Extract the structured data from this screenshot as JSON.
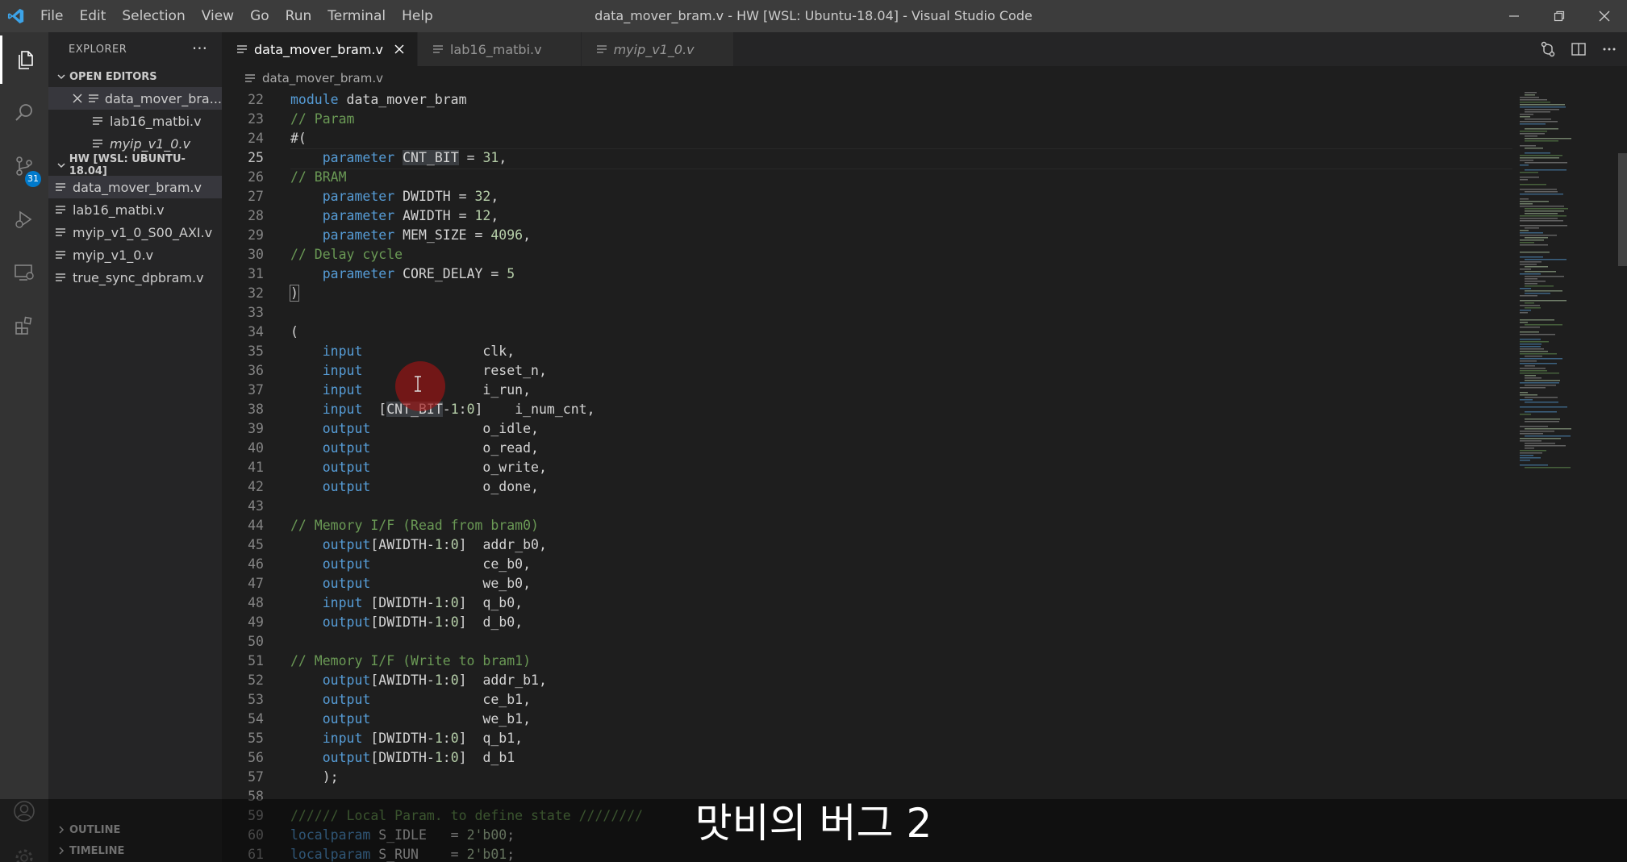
{
  "titlebar": {
    "menu": [
      "File",
      "Edit",
      "Selection",
      "View",
      "Go",
      "Run",
      "Terminal",
      "Help"
    ],
    "title": "data_mover_bram.v - HW [WSL: Ubuntu-18.04] - Visual Studio Code"
  },
  "activity": {
    "scm_badge": "31"
  },
  "sidebar": {
    "header": "EXPLORER",
    "more": "···",
    "open_editors": {
      "title": "OPEN EDITORS",
      "items": [
        "data_mover_bra...",
        "lab16_matbi.v",
        "myip_v1_0.v"
      ]
    },
    "workspace": {
      "title": "HW [WSL: UBUNTU-18.04]",
      "items": [
        "data_mover_bram.v",
        "lab16_matbi.v",
        "myip_v1_0_S00_AXI.v",
        "myip_v1_0.v",
        "true_sync_dpbram.v"
      ]
    },
    "outline": "OUTLINE",
    "timeline": "TIMELINE"
  },
  "tabs": [
    "data_mover_bram.v",
    "lab16_matbi.v",
    "myip_v1_0.v"
  ],
  "breadcrumb": "data_mover_bram.v",
  "code": {
    "current_line": 25,
    "lines": [
      {
        "n": "22",
        "tokens": [
          [
            "kw",
            "module "
          ],
          [
            "tx",
            "data_mover_bram"
          ]
        ]
      },
      {
        "n": "23",
        "tokens": [
          [
            "cm",
            "// Param"
          ]
        ]
      },
      {
        "n": "24",
        "tokens": [
          [
            "tx",
            "#("
          ]
        ]
      },
      {
        "n": "25",
        "tokens": [
          [
            "tx",
            "    "
          ],
          [
            "kw",
            "parameter "
          ],
          [
            "hl",
            "CNT_BIT"
          ],
          [
            "tx",
            " = "
          ],
          [
            "num",
            "31"
          ],
          [
            "tx",
            ","
          ]
        ]
      },
      {
        "n": "26",
        "tokens": [
          [
            "cm",
            "// BRAM"
          ]
        ]
      },
      {
        "n": "27",
        "tokens": [
          [
            "tx",
            "    "
          ],
          [
            "kw",
            "parameter "
          ],
          [
            "tx",
            "DWIDTH = "
          ],
          [
            "num",
            "32"
          ],
          [
            "tx",
            ","
          ]
        ]
      },
      {
        "n": "28",
        "tokens": [
          [
            "tx",
            "    "
          ],
          [
            "kw",
            "parameter "
          ],
          [
            "tx",
            "AWIDTH = "
          ],
          [
            "num",
            "12"
          ],
          [
            "tx",
            ","
          ]
        ]
      },
      {
        "n": "29",
        "tokens": [
          [
            "tx",
            "    "
          ],
          [
            "kw",
            "parameter "
          ],
          [
            "tx",
            "MEM_SIZE = "
          ],
          [
            "num",
            "4096"
          ],
          [
            "tx",
            ","
          ]
        ]
      },
      {
        "n": "30",
        "tokens": [
          [
            "cm",
            "// Delay cycle"
          ]
        ]
      },
      {
        "n": "31",
        "tokens": [
          [
            "tx",
            "    "
          ],
          [
            "kw",
            "parameter "
          ],
          [
            "tx",
            "CORE_DELAY = "
          ],
          [
            "num",
            "5"
          ]
        ]
      },
      {
        "n": "32",
        "tokens": [
          [
            "bx",
            ")"
          ]
        ]
      },
      {
        "n": "33",
        "tokens": []
      },
      {
        "n": "34",
        "tokens": [
          [
            "tx",
            "("
          ]
        ]
      },
      {
        "n": "35",
        "tokens": [
          [
            "tx",
            "    "
          ],
          [
            "kw",
            "input"
          ],
          [
            "tx",
            "               clk,"
          ]
        ]
      },
      {
        "n": "36",
        "tokens": [
          [
            "tx",
            "    "
          ],
          [
            "kw",
            "input"
          ],
          [
            "tx",
            "               reset_n,"
          ]
        ]
      },
      {
        "n": "37",
        "tokens": [
          [
            "tx",
            "    "
          ],
          [
            "kw",
            "input"
          ],
          [
            "tx",
            "               i_run,"
          ]
        ]
      },
      {
        "n": "38",
        "tokens": [
          [
            "tx",
            "    "
          ],
          [
            "kw",
            "input"
          ],
          [
            "tx",
            "  ["
          ],
          [
            "hl",
            "CNT_BIT"
          ],
          [
            "tx",
            "-"
          ],
          [
            "num",
            "1"
          ],
          [
            "tx",
            ":"
          ],
          [
            "num",
            "0"
          ],
          [
            "tx",
            "]    i_num_cnt,"
          ]
        ]
      },
      {
        "n": "39",
        "tokens": [
          [
            "tx",
            "    "
          ],
          [
            "kw",
            "output"
          ],
          [
            "tx",
            "              o_idle,"
          ]
        ]
      },
      {
        "n": "40",
        "tokens": [
          [
            "tx",
            "    "
          ],
          [
            "kw",
            "output"
          ],
          [
            "tx",
            "              o_read,"
          ]
        ]
      },
      {
        "n": "41",
        "tokens": [
          [
            "tx",
            "    "
          ],
          [
            "kw",
            "output"
          ],
          [
            "tx",
            "              o_write,"
          ]
        ]
      },
      {
        "n": "42",
        "tokens": [
          [
            "tx",
            "    "
          ],
          [
            "kw",
            "output"
          ],
          [
            "tx",
            "              o_done,"
          ]
        ]
      },
      {
        "n": "43",
        "tokens": []
      },
      {
        "n": "44",
        "tokens": [
          [
            "cm",
            "// Memory I/F (Read from bram0)"
          ]
        ]
      },
      {
        "n": "45",
        "tokens": [
          [
            "tx",
            "    "
          ],
          [
            "kw",
            "output"
          ],
          [
            "tx",
            "[AWIDTH-"
          ],
          [
            "num",
            "1"
          ],
          [
            "tx",
            ":"
          ],
          [
            "num",
            "0"
          ],
          [
            "tx",
            "]  addr_b0,"
          ]
        ]
      },
      {
        "n": "46",
        "tokens": [
          [
            "tx",
            "    "
          ],
          [
            "kw",
            "output"
          ],
          [
            "tx",
            "              ce_b0,"
          ]
        ]
      },
      {
        "n": "47",
        "tokens": [
          [
            "tx",
            "    "
          ],
          [
            "kw",
            "output"
          ],
          [
            "tx",
            "              we_b0,"
          ]
        ]
      },
      {
        "n": "48",
        "tokens": [
          [
            "tx",
            "    "
          ],
          [
            "kw",
            "input"
          ],
          [
            "tx",
            " [DWIDTH-"
          ],
          [
            "num",
            "1"
          ],
          [
            "tx",
            ":"
          ],
          [
            "num",
            "0"
          ],
          [
            "tx",
            "]  q_b0,"
          ]
        ]
      },
      {
        "n": "49",
        "tokens": [
          [
            "tx",
            "    "
          ],
          [
            "kw",
            "output"
          ],
          [
            "tx",
            "[DWIDTH-"
          ],
          [
            "num",
            "1"
          ],
          [
            "tx",
            ":"
          ],
          [
            "num",
            "0"
          ],
          [
            "tx",
            "]  d_b0,"
          ]
        ]
      },
      {
        "n": "50",
        "tokens": []
      },
      {
        "n": "51",
        "tokens": [
          [
            "cm",
            "// Memory I/F (Write to bram1)"
          ]
        ]
      },
      {
        "n": "52",
        "tokens": [
          [
            "tx",
            "    "
          ],
          [
            "kw",
            "output"
          ],
          [
            "tx",
            "[AWIDTH-"
          ],
          [
            "num",
            "1"
          ],
          [
            "tx",
            ":"
          ],
          [
            "num",
            "0"
          ],
          [
            "tx",
            "]  addr_b1,"
          ]
        ]
      },
      {
        "n": "53",
        "tokens": [
          [
            "tx",
            "    "
          ],
          [
            "kw",
            "output"
          ],
          [
            "tx",
            "              ce_b1,"
          ]
        ]
      },
      {
        "n": "54",
        "tokens": [
          [
            "tx",
            "    "
          ],
          [
            "kw",
            "output"
          ],
          [
            "tx",
            "              we_b1,"
          ]
        ]
      },
      {
        "n": "55",
        "tokens": [
          [
            "tx",
            "    "
          ],
          [
            "kw",
            "input"
          ],
          [
            "tx",
            " [DWIDTH-"
          ],
          [
            "num",
            "1"
          ],
          [
            "tx",
            ":"
          ],
          [
            "num",
            "0"
          ],
          [
            "tx",
            "]  q_b1,"
          ]
        ]
      },
      {
        "n": "56",
        "tokens": [
          [
            "tx",
            "    "
          ],
          [
            "kw",
            "output"
          ],
          [
            "tx",
            "[DWIDTH-"
          ],
          [
            "num",
            "1"
          ],
          [
            "tx",
            ":"
          ],
          [
            "num",
            "0"
          ],
          [
            "tx",
            "]  d_b1"
          ]
        ]
      },
      {
        "n": "57",
        "tokens": [
          [
            "tx",
            "    );"
          ]
        ]
      },
      {
        "n": "58",
        "tokens": []
      },
      {
        "n": "59",
        "tokens": [
          [
            "cm",
            "////// Local Param. to define state ////////"
          ]
        ]
      },
      {
        "n": "60",
        "tokens": [
          [
            "kw",
            "localparam"
          ],
          [
            "tx",
            " S_IDLE   = "
          ],
          [
            "num",
            "2'b00"
          ],
          [
            "tx",
            ";"
          ]
        ]
      },
      {
        "n": "61",
        "tokens": [
          [
            "kw",
            "localparam"
          ],
          [
            "tx",
            " S_RUN    = "
          ],
          [
            "num",
            "2'b01"
          ],
          [
            "tx",
            ";"
          ]
        ]
      }
    ]
  },
  "caption": "맛비의 버그 2",
  "colors": {
    "keyword": "#569cd6",
    "comment": "#6a9955",
    "number": "#b5cea8",
    "accent": "#007acc"
  }
}
